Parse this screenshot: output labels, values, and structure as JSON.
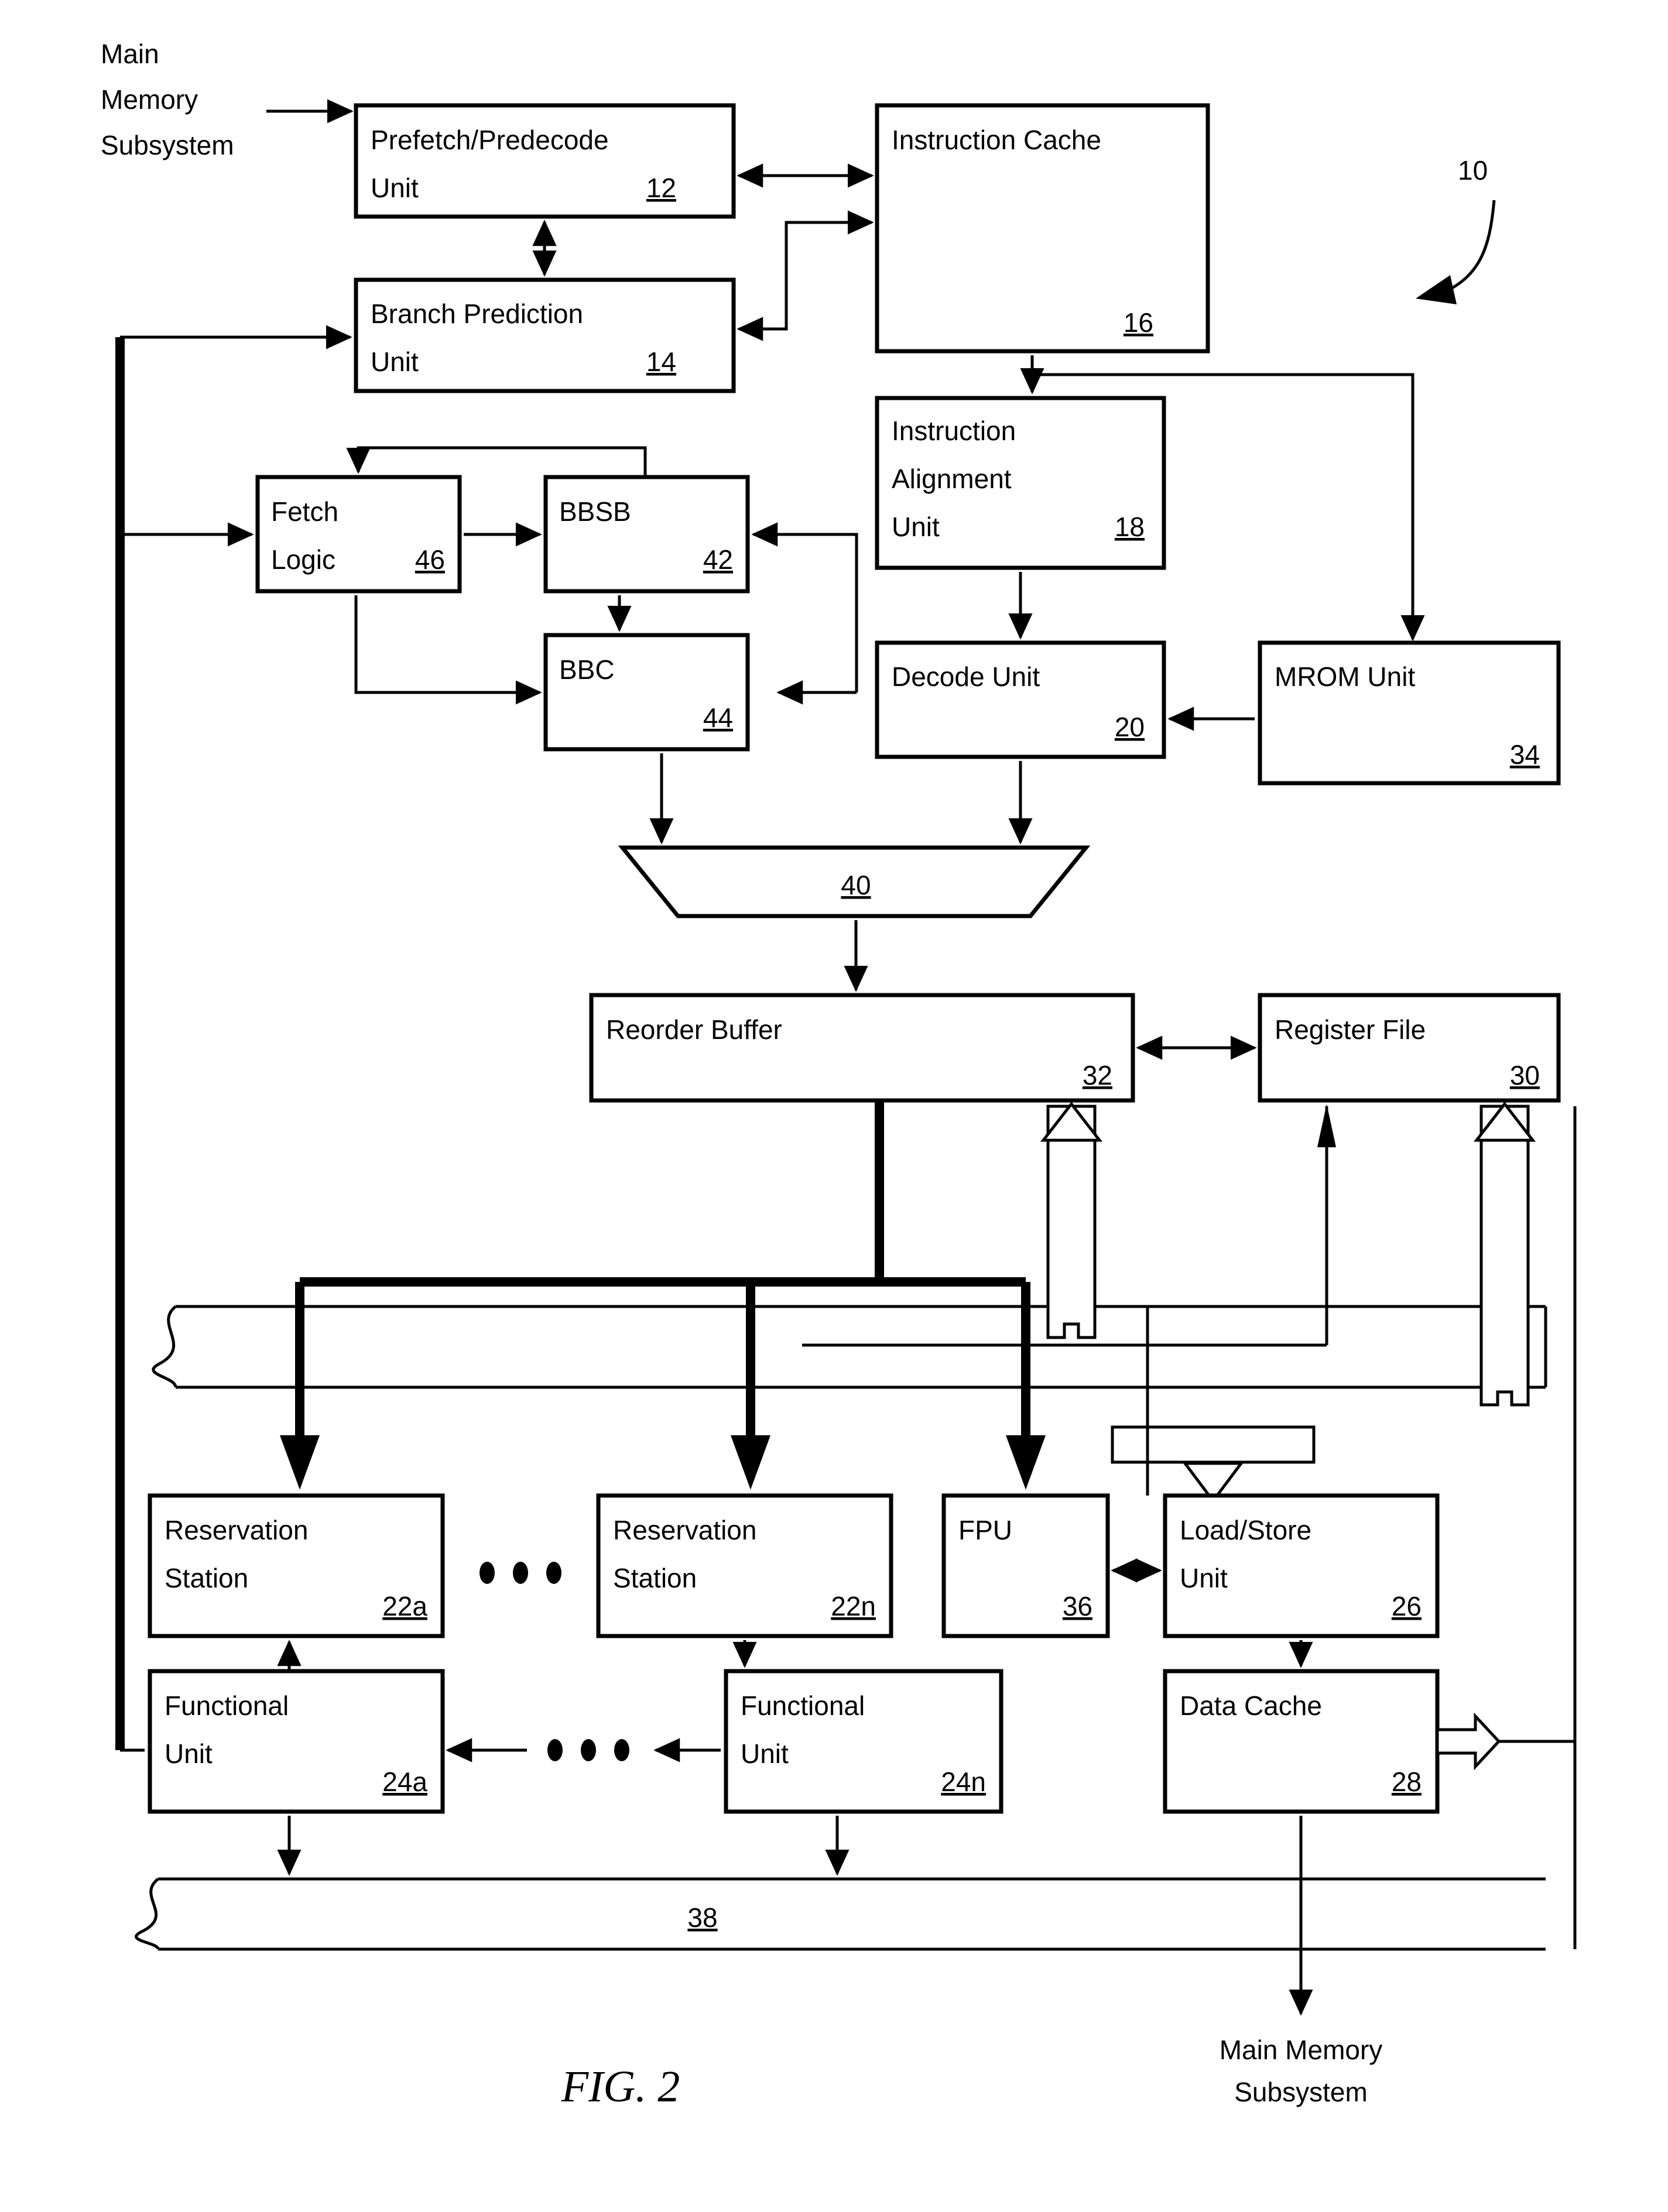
{
  "figure": {
    "caption": "FIG. 2",
    "system_ref": "10"
  },
  "external_labels": [
    {
      "id": "main-memory-in",
      "lines": [
        "Main",
        "Memory",
        "Subsystem"
      ]
    },
    {
      "id": "main-memory-out",
      "lines": [
        "Main Memory",
        "Subsystem"
      ]
    }
  ],
  "blocks": [
    {
      "id": "prefetch-predecode-unit",
      "lines": [
        "Prefetch/Predecode",
        "Unit"
      ],
      "ref": "12"
    },
    {
      "id": "instruction-cache",
      "lines": [
        "Instruction Cache"
      ],
      "ref": "16"
    },
    {
      "id": "branch-prediction-unit",
      "lines": [
        "Branch Prediction",
        "Unit"
      ],
      "ref": "14"
    },
    {
      "id": "fetch-logic",
      "lines": [
        "Fetch",
        "Logic"
      ],
      "ref": "46"
    },
    {
      "id": "bbsb",
      "lines": [
        "BBSB"
      ],
      "ref": "42"
    },
    {
      "id": "bbc",
      "lines": [
        "BBC"
      ],
      "ref": "44"
    },
    {
      "id": "instruction-alignment-unit",
      "lines": [
        "Instruction",
        "Alignment",
        "Unit"
      ],
      "ref": "18"
    },
    {
      "id": "decode-unit",
      "lines": [
        "Decode Unit"
      ],
      "ref": "20"
    },
    {
      "id": "mrom-unit",
      "lines": [
        "MROM Unit"
      ],
      "ref": "34"
    },
    {
      "id": "multiplexer",
      "lines": [],
      "ref": "40"
    },
    {
      "id": "reorder-buffer",
      "lines": [
        "Reorder Buffer"
      ],
      "ref": "32"
    },
    {
      "id": "register-file",
      "lines": [
        "Register File"
      ],
      "ref": "30"
    },
    {
      "id": "reservation-station-a",
      "lines": [
        "Reservation",
        "Station"
      ],
      "ref": "22a"
    },
    {
      "id": "reservation-station-n",
      "lines": [
        "Reservation",
        "Station"
      ],
      "ref": "22n"
    },
    {
      "id": "fpu",
      "lines": [
        "FPU"
      ],
      "ref": "36"
    },
    {
      "id": "load-store-unit",
      "lines": [
        "Load/Store",
        "Unit"
      ],
      "ref": "26"
    },
    {
      "id": "functional-unit-a",
      "lines": [
        "Functional",
        "Unit"
      ],
      "ref": "24a"
    },
    {
      "id": "functional-unit-n",
      "lines": [
        "Functional",
        "Unit"
      ],
      "ref": "24n"
    },
    {
      "id": "data-cache",
      "lines": [
        "Data Cache"
      ],
      "ref": "28"
    },
    {
      "id": "result-bus",
      "lines": [],
      "ref": "38"
    }
  ],
  "colors": {
    "ink": "#000000",
    "paper": "#ffffff"
  }
}
